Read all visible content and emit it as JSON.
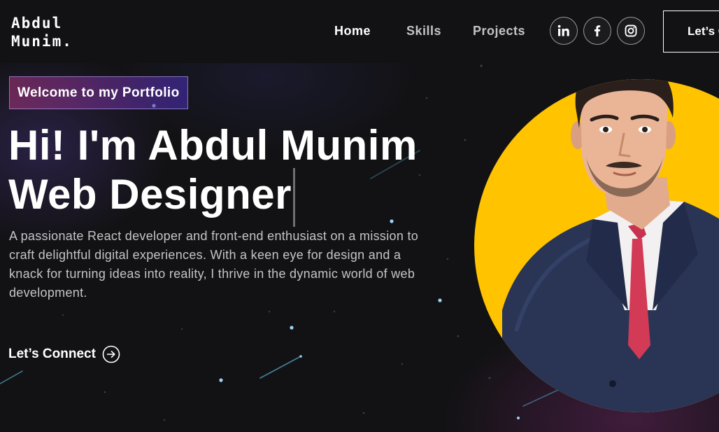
{
  "brand": {
    "logo_line1": "Abdul",
    "logo_line2": "Munim."
  },
  "nav": {
    "items": [
      {
        "label": "Home",
        "active": true
      },
      {
        "label": "Skills",
        "active": false
      },
      {
        "label": "Projects",
        "active": false
      }
    ],
    "socials": [
      {
        "icon": "linkedin-icon"
      },
      {
        "icon": "facebook-icon"
      },
      {
        "icon": "instagram-icon"
      }
    ],
    "cta_label": "Let’s Connect"
  },
  "hero": {
    "tagline": "Welcome to my Portfolio",
    "headline_line1": "Hi! I'm Abdul Munim",
    "headline_line2": "Web Designer",
    "description": "A passionate React developer and front-end enthusiast on a mission to craft delightful digital experiences. With a keen eye for design and a knack for turning ideas into reality, I thrive in the dynamic world of web development.",
    "connect_label": "Let’s Connect",
    "connect_icon": "arrow-right-circle-icon"
  },
  "colors": {
    "background": "#121214",
    "portrait_circle": "#ffc300",
    "tagline_gradient_start": "#aa367c",
    "tagline_gradient_end": "#4a2fbd",
    "text_muted": "#c4c4c8"
  }
}
